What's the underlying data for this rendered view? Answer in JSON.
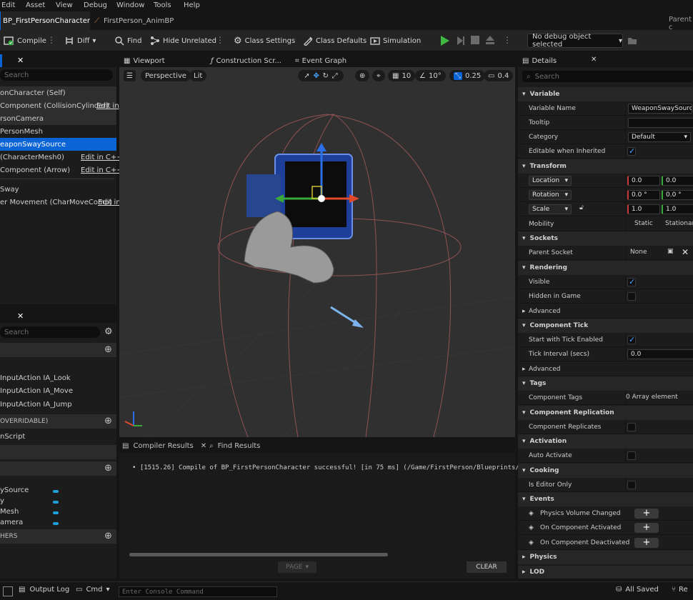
{
  "menubar": {
    "items": [
      "Edit",
      "Asset",
      "View",
      "Debug",
      "Window",
      "Tools",
      "Help"
    ]
  },
  "tabs": {
    "active": "BP_FirstPersonCharacter",
    "second": "FirstPerson_AnimBP",
    "parent": "Parent c"
  },
  "toolbar": {
    "compile": "Compile",
    "diff": "Diff",
    "find": "Find",
    "hide_unrelated": "Hide Unrelated",
    "class_settings": "Class Settings",
    "class_defaults": "Class Defaults",
    "simulation": "Simulation",
    "debug_object": "No debug object selected"
  },
  "components": {
    "search_placeholder": "Search",
    "items": [
      {
        "label": "onCharacter (Self)",
        "edit": ""
      },
      {
        "label": "Component (CollisionCylinder)",
        "edit": "Edit in"
      },
      {
        "label": "rsonCamera",
        "edit": ""
      },
      {
        "label": "PersonMesh",
        "edit": ""
      },
      {
        "label": "eaponSwaySource",
        "edit": ""
      },
      {
        "label": "(CharacterMesh0)",
        "edit": "Edit in C++"
      },
      {
        "label": "Component (Arrow)",
        "edit": "Edit in C++"
      },
      {
        "label": "Sway",
        "edit": ""
      },
      {
        "label": "er Movement (CharMoveComp)",
        "edit": "Edit in"
      }
    ]
  },
  "my_blueprint": {
    "search_placeholder": "Search",
    "input_items": [
      "InputAction IA_Look",
      "InputAction IA_Move",
      "InputAction IA_Jump"
    ],
    "overridable": "OVERRIDABLE)",
    "script": "nScript",
    "vars": [
      "ySource",
      "y",
      "Mesh",
      "amera"
    ],
    "dispatchers": "HERS"
  },
  "viewport": {
    "tabs": [
      "Viewport",
      "Construction Scr...",
      "Event Graph"
    ],
    "perspective": "Perspective",
    "lit": "Lit",
    "grid": "10",
    "rot": "10°",
    "scale": "0.25",
    "cam": "0.4"
  },
  "compiler": {
    "tab": "Compiler Results",
    "find": "Find Results",
    "message": "[1515.26] Compile of BP_FirstPersonCharacter successful! [in 75 ms] (/Game/FirstPerson/Blueprints/",
    "page": "PAGE",
    "clear": "CLEAR"
  },
  "details": {
    "title": "Details",
    "search_placeholder": "Search",
    "variable": {
      "section": "Variable",
      "name_label": "Variable Name",
      "name_value": "WeaponSwaySource",
      "tooltip": "Tooltip",
      "category": "Category",
      "category_value": "Default",
      "editable": "Editable when Inherited"
    },
    "transform": {
      "section": "Transform",
      "location": "Location",
      "rotation": "Rotation",
      "scale": "Scale",
      "loc_x": "0.0",
      "loc_y": "0.0",
      "rot_x": "0.0 °",
      "rot_y": "0.0 °",
      "scale_x": "1.0",
      "scale_y": "1.0",
      "mobility": "Mobility",
      "static": "Static",
      "stationary": "Stationar"
    },
    "sockets": {
      "section": "Sockets",
      "parent": "Parent Socket",
      "value": "None"
    },
    "rendering": {
      "section": "Rendering",
      "visible": "Visible",
      "hidden": "Hidden in Game",
      "advanced": "Advanced"
    },
    "tick": {
      "section": "Component Tick",
      "start": "Start with Tick Enabled",
      "interval": "Tick Interval (secs)",
      "interval_value": "0.0",
      "advanced": "Advanced"
    },
    "tags": {
      "section": "Tags",
      "label": "Component Tags",
      "value": "0 Array element"
    },
    "replication": {
      "section": "Component Replication",
      "label": "Component Replicates"
    },
    "activation": {
      "section": "Activation",
      "label": "Auto Activate"
    },
    "cooking": {
      "section": "Cooking",
      "label": "Is Editor Only"
    },
    "events": {
      "section": "Events",
      "items": [
        "Physics Volume Changed",
        "On Component Activated",
        "On Component Deactivated"
      ]
    },
    "physics": {
      "section": "Physics"
    },
    "lod": {
      "section": "LOD"
    }
  },
  "status": {
    "output_log": "Output Log",
    "cmd": "Cmd",
    "console_placeholder": "Enter Console Command",
    "saved": "All Saved",
    "rev": "Re"
  },
  "colors": {
    "accent": "#0a64d6",
    "play": "#3fb93f",
    "bg": "#1c1c1c"
  }
}
